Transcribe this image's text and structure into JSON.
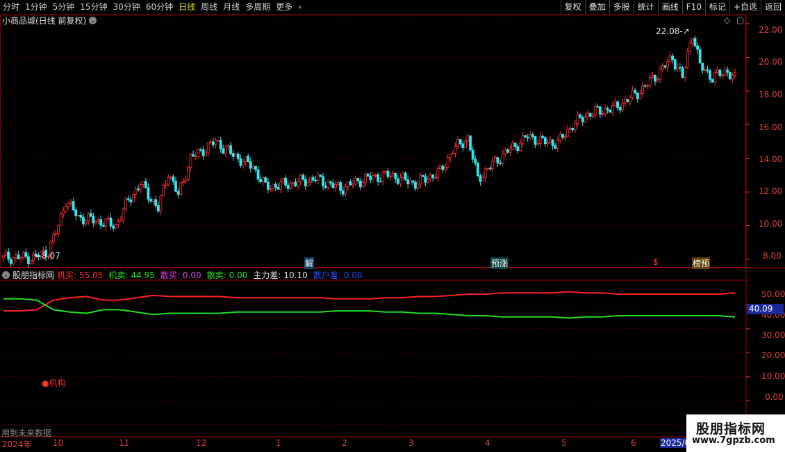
{
  "toolbar": {
    "periods": [
      "分时",
      "1分钟",
      "5分钟",
      "15分钟",
      "30分钟",
      "60分钟",
      "日线",
      "周线",
      "月线",
      "多周期",
      "更多"
    ],
    "active_period": "日线",
    "buttons": [
      "复权",
      "叠加",
      "多股",
      "统计",
      "画线",
      "F10",
      "标记",
      "+自选",
      "返回"
    ]
  },
  "symbol": {
    "title": "小商品城(日线 前复权)"
  },
  "main_chart": {
    "high_label": "22.08",
    "low_label": "8.07",
    "y_ticks": [
      "22.00",
      "20.00",
      "18.00",
      "16.00",
      "14.00",
      "12.00",
      "10.00",
      "8.00"
    ],
    "markers": [
      {
        "text": "解",
        "color": "#3aa0ff"
      },
      {
        "text": "预涨",
        "color": "#40c0c0"
      },
      {
        "text": "$",
        "color": "#ff3030"
      },
      {
        "text": "榜预",
        "color": "#e0a000"
      }
    ]
  },
  "indicator": {
    "name": "股朋指标网",
    "items": [
      {
        "label": "机买:",
        "value": "55.05",
        "color": "#ff3030"
      },
      {
        "label": "机卖:",
        "value": "44.95",
        "color": "#20e020"
      },
      {
        "label": "散买:",
        "value": "0.00",
        "color": "#e040e0"
      },
      {
        "label": "散卖:",
        "value": "0.00",
        "color": "#20e020"
      },
      {
        "label": "主力差:",
        "value": "10.10",
        "color": "#e0e0e0"
      },
      {
        "label": "散户差:",
        "value": "0.00",
        "color": "#2050ff"
      }
    ],
    "y_ticks": [
      "50.00",
      "40.00",
      "30.00",
      "20.00",
      "10.00",
      "0.00"
    ],
    "current_value": "40.09",
    "label_institution": "●机构",
    "footer_note": "用到未来数据"
  },
  "dates": {
    "labels": [
      "2024年",
      "10",
      "11",
      "12",
      "1",
      "2",
      "3",
      "4",
      "5",
      "6",
      "2025/0"
    ],
    "selected": "2025/0"
  },
  "watermark": {
    "title": "股朋指标网",
    "url": "www.7gpzb.com"
  },
  "colors": {
    "up": "#ff3030",
    "down": "#30e8f0",
    "grid": "#7a0000",
    "axis": "#e04040"
  },
  "chart_data": {
    "type": "candlestick",
    "series": [
      {
        "name": "机买",
        "values": [
          47.5,
          47.5,
          48,
          52,
          53,
          53.5,
          52,
          52,
          53,
          54,
          53.5,
          53.5,
          53.5,
          53.5,
          53,
          53,
          53,
          53,
          53,
          53,
          52.5,
          52.5,
          52.5,
          53,
          53,
          53.5,
          53.5,
          54,
          54.5,
          54.5,
          55,
          55,
          55,
          55,
          55.5,
          55,
          55,
          54.5,
          54.5,
          54.5,
          54.5,
          54.5,
          54.5,
          54.5,
          55.05
        ]
      },
      {
        "name": "机卖",
        "values": [
          52.5,
          52.5,
          52,
          48,
          47,
          46.5,
          48,
          48,
          47,
          46,
          46.5,
          46.5,
          46.5,
          46.5,
          47,
          47,
          47,
          47,
          47,
          47,
          47.5,
          47.5,
          47.5,
          47,
          47,
          46.5,
          46.5,
          46,
          45.5,
          45.5,
          45,
          45,
          45,
          45,
          44.5,
          45,
          45,
          45.5,
          45.5,
          45.5,
          45.5,
          45.5,
          45.5,
          45.5,
          44.95
        ]
      }
    ],
    "ylim_price": [
      7.5,
      22.5
    ],
    "ylim_indicator": [
      -5,
      60
    ]
  }
}
